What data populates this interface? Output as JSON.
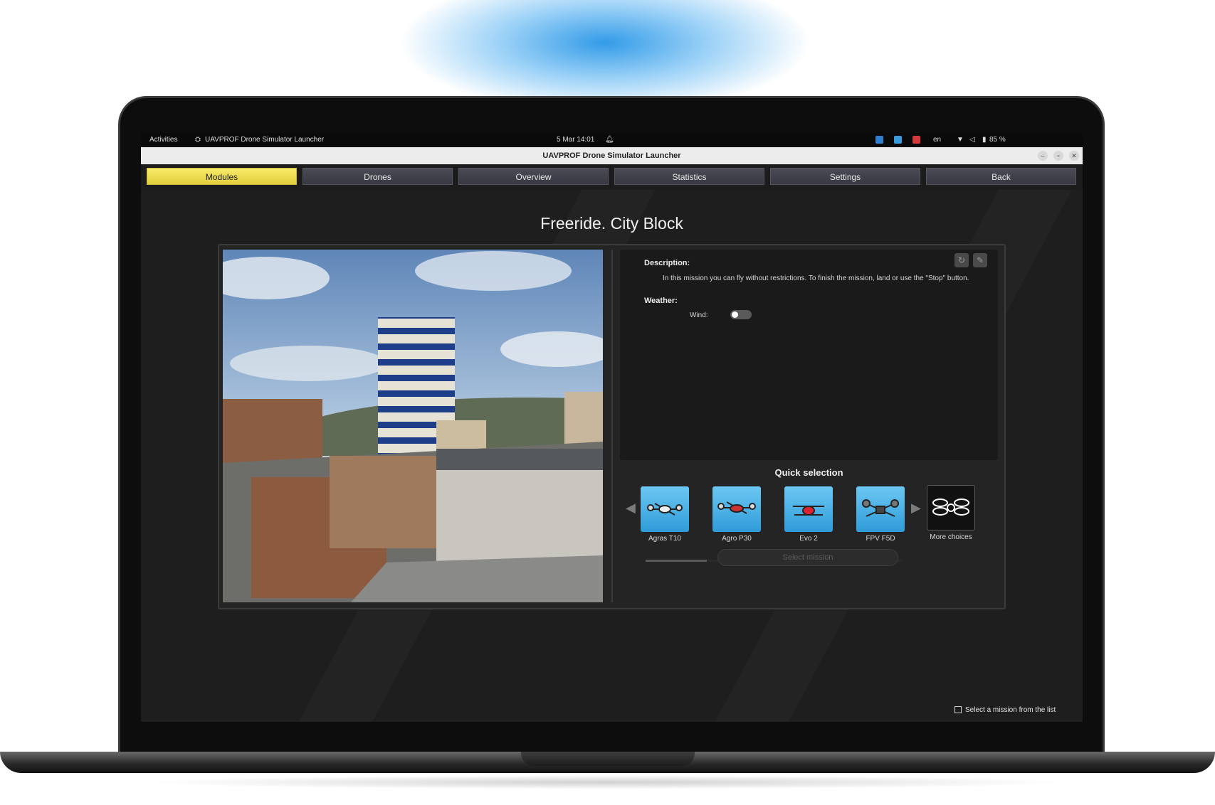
{
  "system_bar": {
    "activities": "Activities",
    "app_name": "UAVPROF Drone Simulator Launcher",
    "datetime": "5 Mar  14:01",
    "lang": "en",
    "battery": "85 %"
  },
  "window": {
    "title": "UAVPROF Drone Simulator Launcher",
    "minimize": "–",
    "restore": "▫",
    "close": "✕"
  },
  "nav": {
    "tabs": [
      {
        "label": "Modules",
        "active": true
      },
      {
        "label": "Drones",
        "active": false
      },
      {
        "label": "Overview",
        "active": false
      },
      {
        "label": "Statistics",
        "active": false
      },
      {
        "label": "Settings",
        "active": false
      },
      {
        "label": "Back",
        "active": false
      }
    ]
  },
  "mission": {
    "title": "Freeride. City Block",
    "description_label": "Description:",
    "description_text": "In this mission you can fly without restrictions. To finish the mission, land or use the \"Stop\" button.",
    "weather_label": "Weather:",
    "wind_label": "Wind:",
    "wind_enabled": false
  },
  "quick_selection": {
    "title": "Quick selection",
    "drones": [
      {
        "name": "Agras T10",
        "icon": "drone-icon"
      },
      {
        "name": "Agro P30",
        "icon": "drone-icon"
      },
      {
        "name": "Evo 2",
        "icon": "drone-icon"
      },
      {
        "name": "FPV F5D",
        "icon": "drone-icon"
      }
    ],
    "more_label": "More choices",
    "select_button": "Select mission"
  },
  "footer": {
    "hint": "Select a mission from the list"
  },
  "colors": {
    "accent_tab": "#f0dd52",
    "drone_card": "#4fb4e6",
    "background": "#1e1e1e"
  }
}
